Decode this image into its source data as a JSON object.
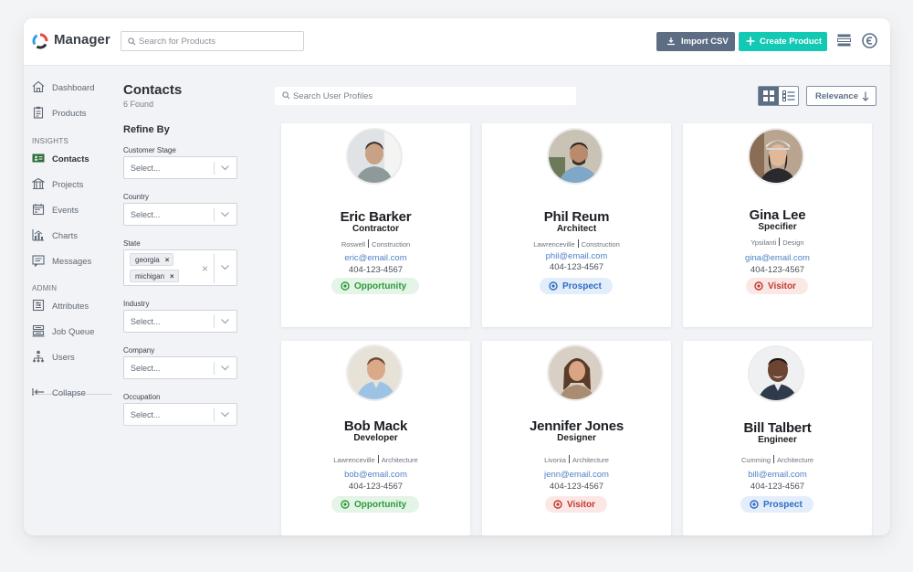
{
  "app": {
    "title": "Manager"
  },
  "topbar": {
    "search_placeholder": "Search for Products",
    "import_label": "Import CSV",
    "create_label": "Create Product"
  },
  "sidebar": {
    "items_top": [
      {
        "label": "Dashboard",
        "icon": "house-icon"
      },
      {
        "label": "Products",
        "icon": "clipboard-icon"
      }
    ],
    "section_insights": "INSIGHTS",
    "items_insights": [
      {
        "label": "Contacts",
        "icon": "contacts-card-icon",
        "active": true
      },
      {
        "label": "Projects",
        "icon": "building-icon"
      },
      {
        "label": "Events",
        "icon": "calendar-icon"
      },
      {
        "label": "Charts",
        "icon": "bar-chart-icon"
      },
      {
        "label": "Messages",
        "icon": "message-icon"
      }
    ],
    "section_admin": "ADMIN",
    "items_admin": [
      {
        "label": "Attributes",
        "icon": "sliders-icon"
      },
      {
        "label": "Job Queue",
        "icon": "server-stack-icon"
      },
      {
        "label": "Users",
        "icon": "org-chart-icon"
      }
    ],
    "collapse_label": "Collapse"
  },
  "filters": {
    "title": "Contacts",
    "count": "6 Found",
    "refine_label": "Refine By",
    "select_placeholder": "Select...",
    "customer_stage": "Customer Stage",
    "country": "Country",
    "state": "State",
    "state_chips": [
      "georgia",
      "michigan"
    ],
    "industry": "Industry",
    "company": "Company",
    "occupation": "Occupation"
  },
  "main": {
    "search_placeholder": "Search User Profiles",
    "sort_label": "Relevance"
  },
  "contacts": [
    {
      "name": "Eric Barker",
      "role": "Contractor",
      "city": "Roswell",
      "industry": "Construction",
      "email": "eric@email.com",
      "phone": "404-123-4567",
      "stage": "Opportunity"
    },
    {
      "name": "Phil Reum",
      "role": "Architect",
      "city": "Lawrenceville",
      "industry": "Construction",
      "email": "phil@email.com",
      "phone": "404-123-4567",
      "stage": "Prospect"
    },
    {
      "name": "Gina Lee",
      "role": "Specifier",
      "city": "Ypsilanti",
      "industry": "Design",
      "email": "gina@email.com",
      "phone": "404-123-4567",
      "stage": "Visitor"
    },
    {
      "name": "Bob Mack",
      "role": "Developer",
      "city": "Lawrenceville",
      "industry": "Architecture",
      "email": "bob@email.com",
      "phone": "404-123-4567",
      "stage": "Opportunity"
    },
    {
      "name": "Jennifer Jones",
      "role": "Designer",
      "city": "Livonia",
      "industry": "Architecture",
      "email": "jenn@email.com",
      "phone": "404-123-4567",
      "stage": "Visitor"
    },
    {
      "name": "Bill Talbert",
      "role": "Engineer",
      "city": "Cumming",
      "industry": "Architecture",
      "email": "bill@email.com",
      "phone": "404-123-4567",
      "stage": "Prospect"
    }
  ],
  "colors": {
    "accent_teal": "#14c9b4",
    "slate": "#5c6d84",
    "opportunity": "#2f9a3b",
    "prospect": "#2f6bc5",
    "visitor": "#c0392b"
  }
}
